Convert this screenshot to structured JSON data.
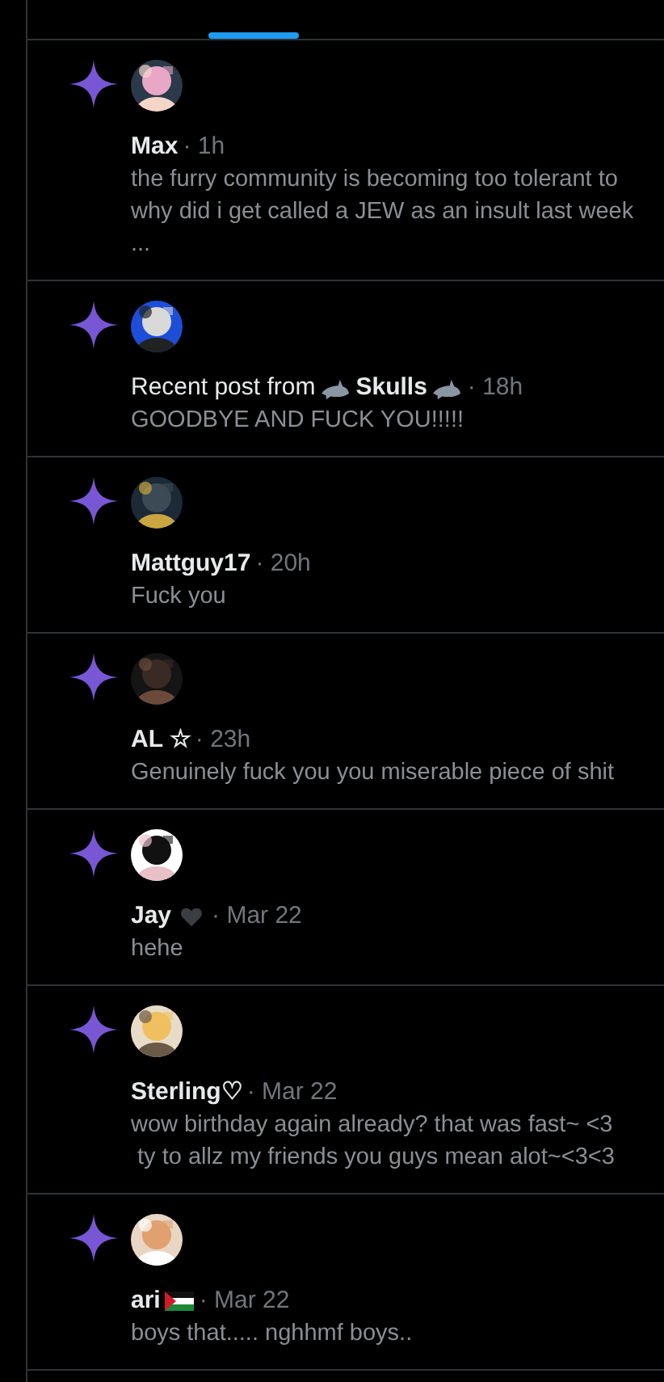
{
  "notifications": [
    {
      "name": "Max",
      "time": "· 1h",
      "lines": [
        "the furry community is becoming too tolerant to",
        "why did i get called a JEW as an insult last week",
        "..."
      ]
    },
    {
      "prefix": "Recent post from",
      "icons_before": [
        {
          "kind": "shark"
        }
      ],
      "name": "Skulls",
      "icons_after": [
        {
          "kind": "shark"
        }
      ],
      "time": "· 18h",
      "lines": [
        "GOODBYE AND FUCK YOU!!!!!"
      ]
    },
    {
      "name": "Mattguy17",
      "time": "· 20h",
      "lines": [
        "Fuck you"
      ]
    },
    {
      "name": "AL ☆",
      "time": "· 23h",
      "lines": [
        "Genuinely fuck you you miserable piece of shit"
      ]
    },
    {
      "name": "Jay",
      "icons_after": [
        {
          "kind": "heart"
        }
      ],
      "time": "· Mar 22",
      "lines": [
        "hehe"
      ]
    },
    {
      "name": "Sterling♡",
      "time": "· Mar 22",
      "lines": [
        "wow birthday again already? that was fast~ <3",
        " ty to allz my friends you guys mean alot~<3<3"
      ]
    },
    {
      "name": "ari",
      "icons_after": [
        {
          "kind": "flag"
        }
      ],
      "time": "· Mar 22",
      "lines": [
        "boys that..... nghhmf boys.."
      ]
    }
  ]
}
